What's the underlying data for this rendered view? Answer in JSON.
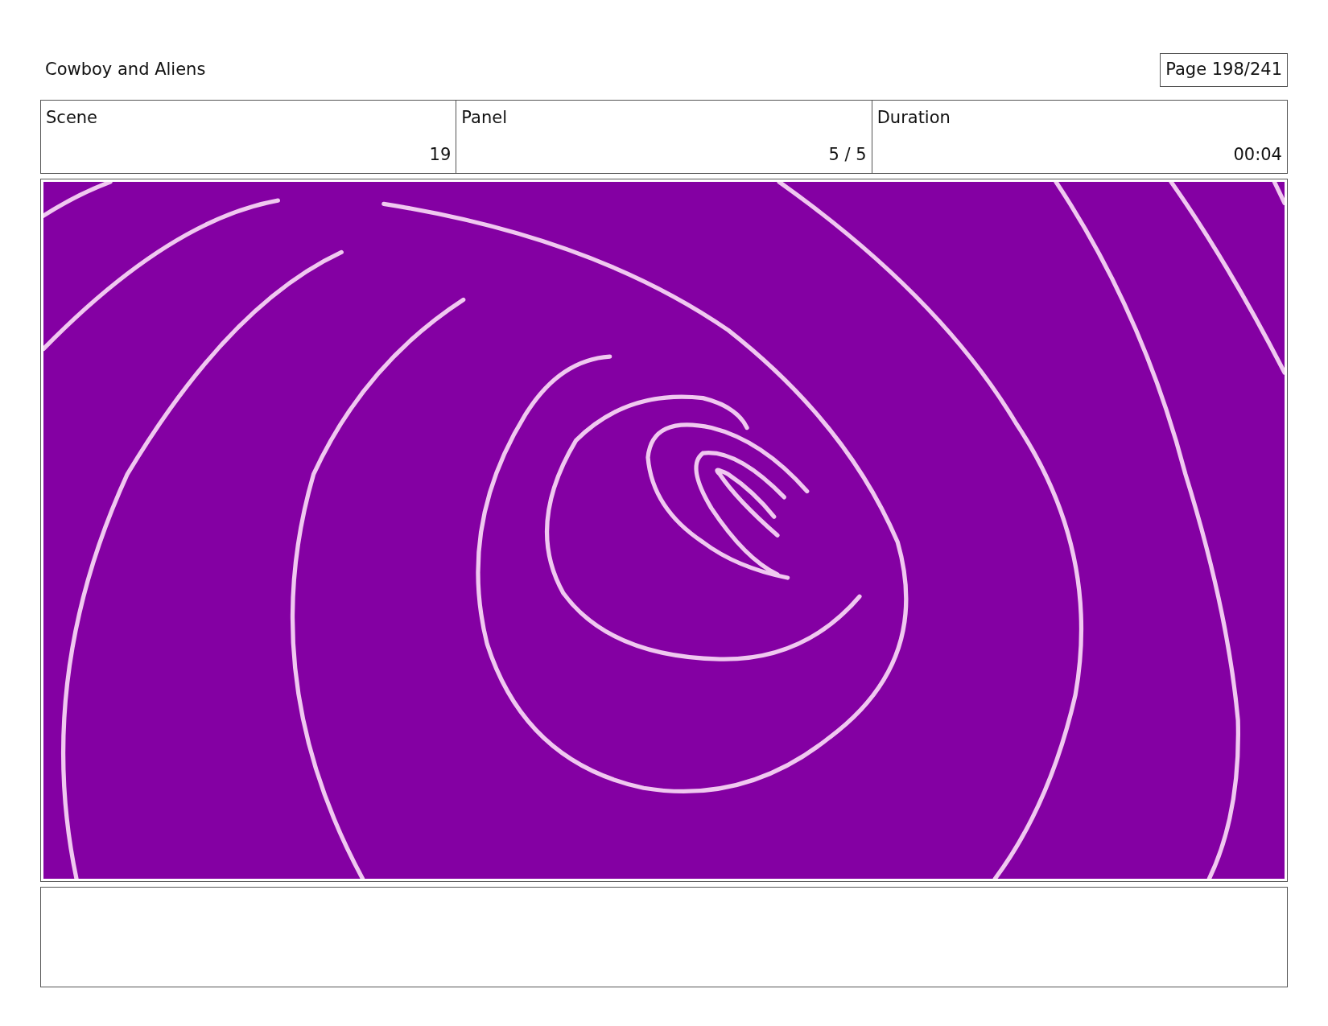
{
  "title": "Cowboy and Aliens",
  "page": "Page 198/241",
  "info_table": {
    "columns": [
      "Scene",
      "Panel",
      "Duration"
    ],
    "rows": [
      [
        "19",
        "5 / 5",
        "00:04"
      ]
    ]
  }
}
